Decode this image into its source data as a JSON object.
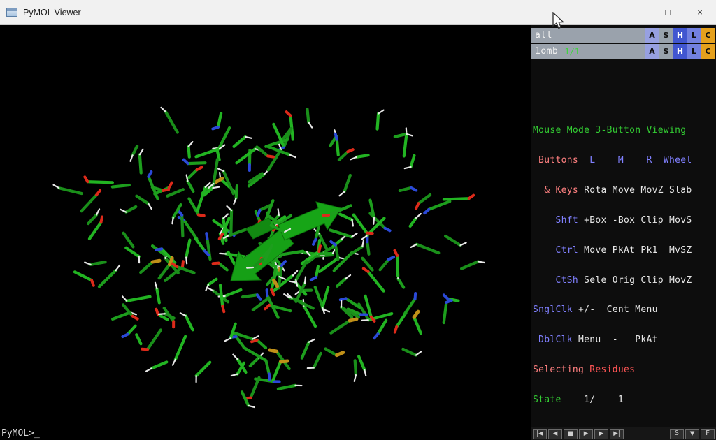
{
  "window": {
    "title": "PyMOL Viewer",
    "controls": {
      "minimize": "—",
      "maximize": "□",
      "close": "×"
    }
  },
  "viewport": {
    "background": "#000000",
    "atom_colors": {
      "carbon": "#21a521",
      "oxygen": "#dd2a1a",
      "nitrogen": "#2b49d8",
      "hydrogen": "#e9e9e9",
      "sulfur": "#c09018"
    }
  },
  "object_panel": {
    "row_background": "#9aa2ac",
    "button_colors": {
      "A": "#97a0e0",
      "S": "#98a2ac",
      "H": "#4156d0",
      "L": "#7280e0",
      "C": "#e5a01c"
    },
    "rows": [
      {
        "name": "all",
        "state": "",
        "buttons": [
          "A",
          "S",
          "H",
          "L",
          "C"
        ]
      },
      {
        "name": "1omb",
        "state": "1/1",
        "buttons": [
          "A",
          "S",
          "H",
          "L",
          "C"
        ]
      }
    ]
  },
  "mouse_panel": {
    "colors": {
      "green": "#33cc33",
      "salmon": "#ff8080",
      "blue": "#8080ff",
      "white": "#e6e6e6",
      "red": "#ff5555"
    },
    "lines": [
      {
        "segments": [
          {
            "text": "Mouse Mode",
            "color": "green"
          },
          {
            "text": " 3-Button Viewing",
            "color": "green"
          }
        ]
      },
      {
        "segments": [
          {
            "text": " Buttons",
            "color": "salmon"
          },
          {
            "text": "  L    M    R  Wheel",
            "color": "blue"
          }
        ]
      },
      {
        "segments": [
          {
            "text": "  & Keys",
            "color": "salmon"
          },
          {
            "text": " Rota Move MovZ Slab",
            "color": "white"
          }
        ]
      },
      {
        "segments": [
          {
            "text": "    Shft",
            "color": "blue"
          },
          {
            "text": " +Box -Box Clip MovS",
            "color": "white"
          }
        ]
      },
      {
        "segments": [
          {
            "text": "    Ctrl",
            "color": "blue"
          },
          {
            "text": " Move PkAt Pk1  MvSZ",
            "color": "white"
          }
        ]
      },
      {
        "segments": [
          {
            "text": "    CtSh",
            "color": "blue"
          },
          {
            "text": " Sele Orig Clip MovZ",
            "color": "white"
          }
        ]
      },
      {
        "segments": [
          {
            "text": "SnglClk",
            "color": "blue"
          },
          {
            "text": " +/-  Cent Menu",
            "color": "white"
          }
        ]
      },
      {
        "segments": [
          {
            "text": " DblClk",
            "color": "blue"
          },
          {
            "text": " Menu  -   PkAt",
            "color": "white"
          }
        ]
      },
      {
        "segments": [
          {
            "text": "Selecting ",
            "color": "salmon"
          },
          {
            "text": "Residues",
            "color": "red"
          }
        ]
      },
      {
        "segments": [
          {
            "text": "State ",
            "color": "green"
          },
          {
            "text": "   1/    1",
            "color": "white"
          }
        ]
      }
    ]
  },
  "command_line": {
    "prompt": "PyMOL>",
    "cursor": "_"
  },
  "playback": {
    "buttons": [
      {
        "name": "go-to-start",
        "label": "|◀"
      },
      {
        "name": "step-back",
        "label": "◀"
      },
      {
        "name": "stop",
        "label": "■"
      },
      {
        "name": "play",
        "label": "▶"
      },
      {
        "name": "step-forward",
        "label": "▶"
      },
      {
        "name": "go-to-end",
        "label": "▶|"
      },
      {
        "name": "scene-toggle",
        "label": "S"
      },
      {
        "name": "dropdown",
        "label": "▼"
      },
      {
        "name": "fullscreen-toggle",
        "label": "F"
      }
    ]
  }
}
